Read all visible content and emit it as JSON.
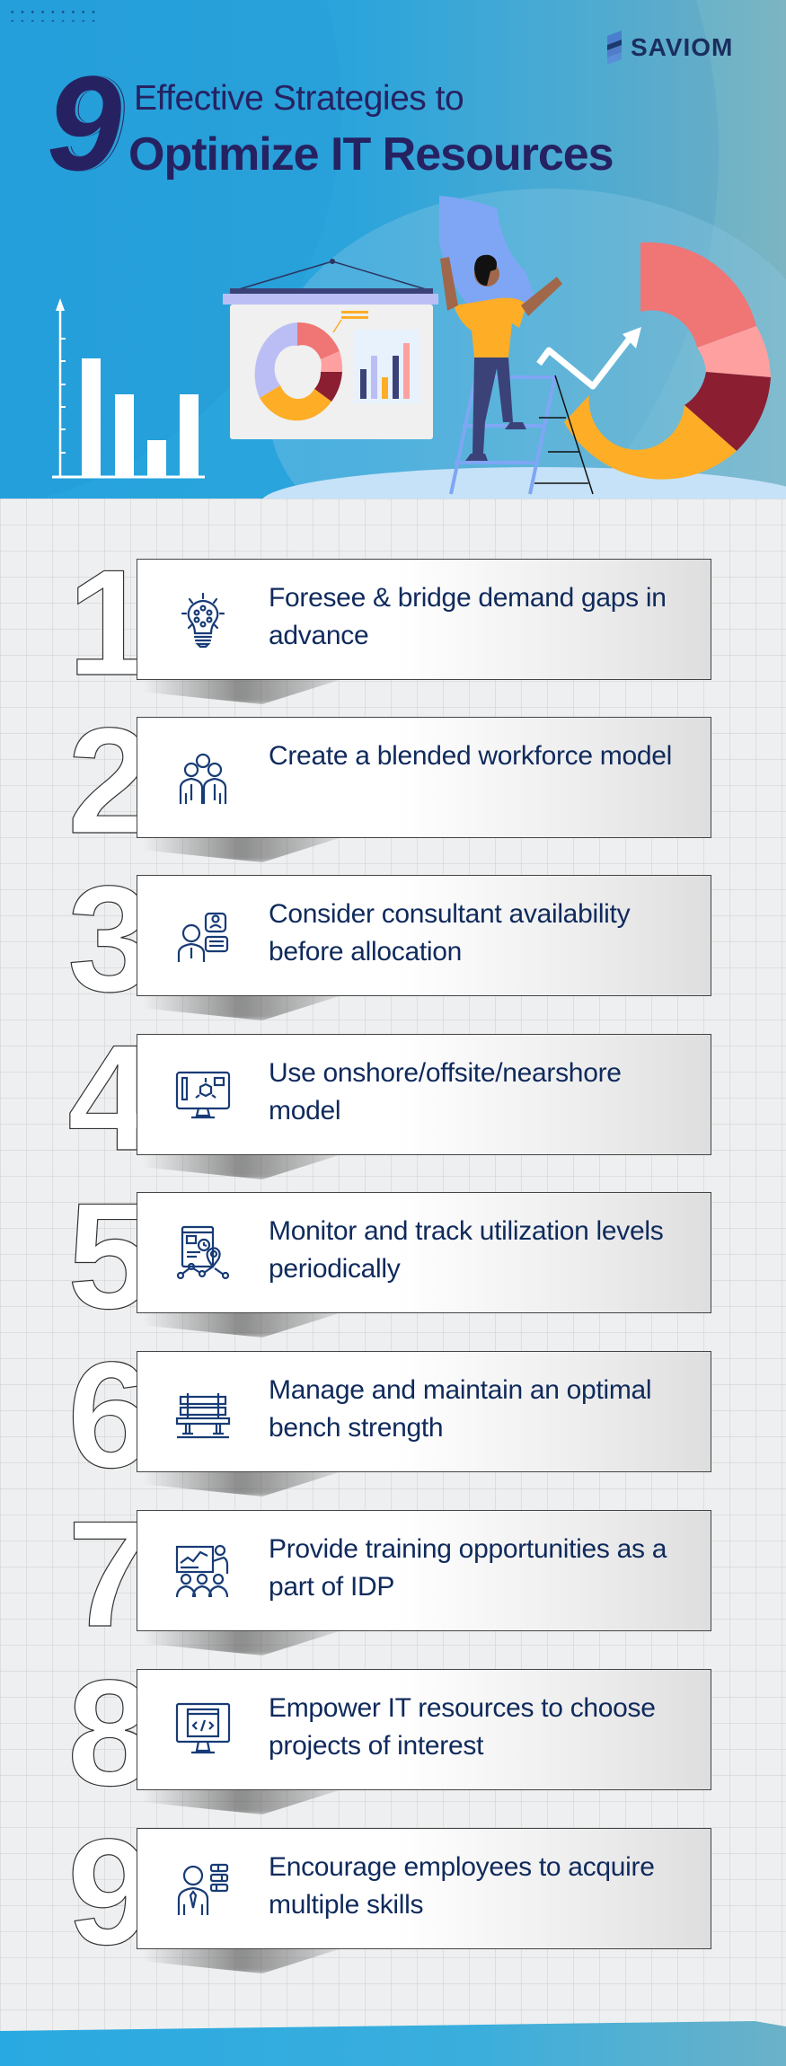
{
  "brand": {
    "name": "SAVIOM",
    "logo_icon": "saviom-s-logo-icon"
  },
  "title": {
    "number": "9",
    "line1": "Effective Strategies to",
    "line2": "Optimize IT Resources"
  },
  "colors": {
    "header_blue": "#29A9E1",
    "title_navy": "#262262",
    "text_navy": "#0F2A5C",
    "coral": "#F07575",
    "pink": "#FFA0A0",
    "maroon": "#8B1E30",
    "orange": "#FDAD26",
    "lavender": "#BBBEF5",
    "periwinkle": "#7FA6F4"
  },
  "strategies": [
    {
      "number": "1",
      "icon": "lightbulb-network-icon",
      "text": "Foresee & bridge demand gaps in advance"
    },
    {
      "number": "2",
      "icon": "team-group-icon",
      "text": "Create a blended workforce model"
    },
    {
      "number": "3",
      "icon": "consultant-chat-icon",
      "text": "Consider consultant availability before allocation"
    },
    {
      "number": "4",
      "icon": "monitor-3d-box-icon",
      "text": "Use onshore/offsite/nearshore model"
    },
    {
      "number": "5",
      "icon": "report-clock-location-icon",
      "text": "Monitor and track utilization levels periodically"
    },
    {
      "number": "6",
      "icon": "bench-icon",
      "text": "Manage and maintain an optimal bench strength"
    },
    {
      "number": "7",
      "icon": "training-presentation-icon",
      "text": "Provide training opportunities as a part of IDP"
    },
    {
      "number": "8",
      "icon": "code-monitor-icon",
      "text": "Empower IT resources to choose projects of interest"
    },
    {
      "number": "9",
      "icon": "employee-skills-icon",
      "text": "Encourage employees to acquire multiple skills"
    }
  ]
}
